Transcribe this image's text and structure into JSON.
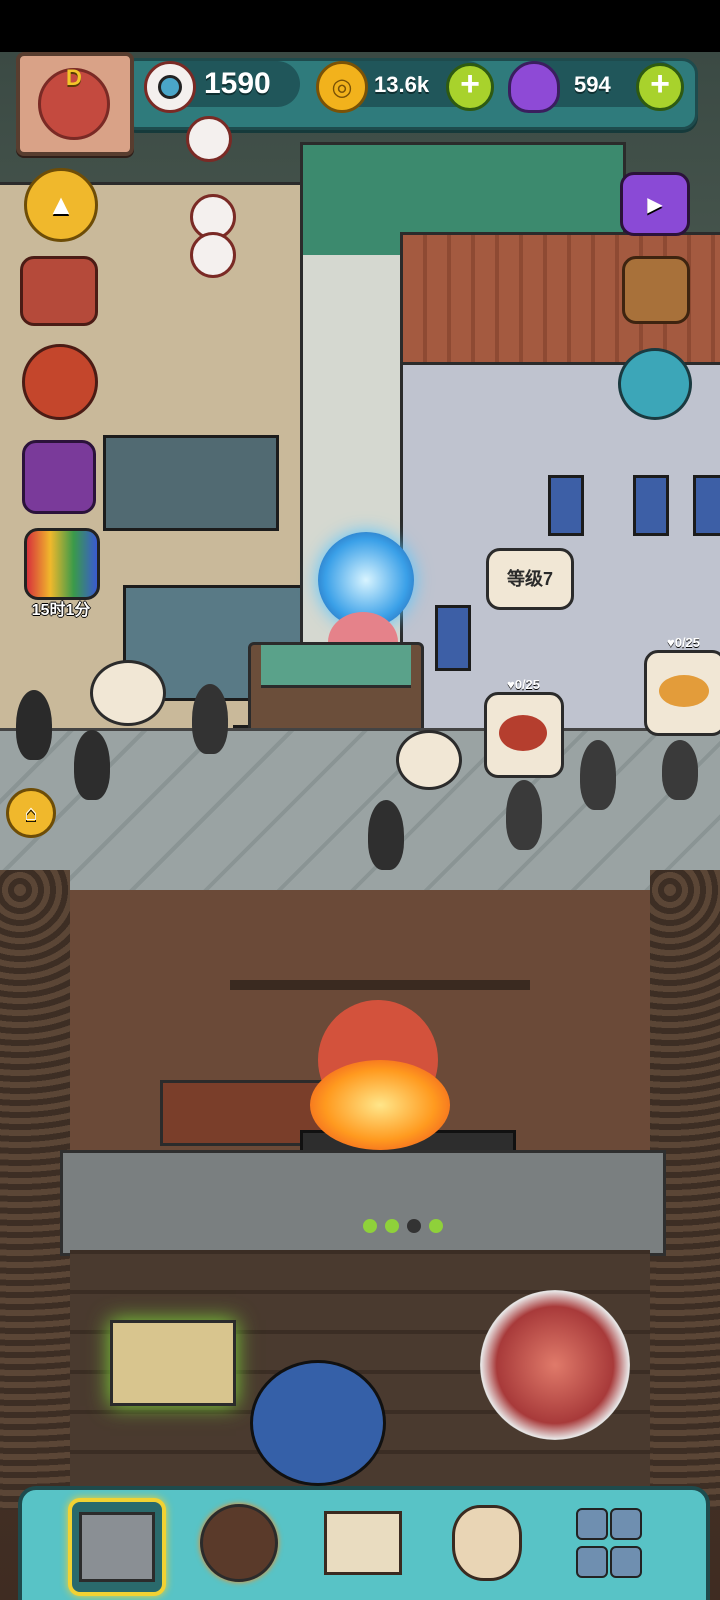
{
  "hud": {
    "avatar_letter": "D",
    "eyeballs": "1590",
    "coins": "13.6k",
    "potions": "594",
    "plus": "+"
  },
  "side": {
    "timer": "15时1分"
  },
  "world": {
    "level_bubble": "等级7",
    "order_1": "0/25",
    "order_2": "0/25"
  },
  "nav": {
    "items": [
      "restaurant",
      "monster",
      "recipes",
      "coin-bag",
      "grid"
    ]
  },
  "colors": {
    "hud_teal": "#2f7b7c",
    "plus_green": "#a8d22c",
    "nav_teal": "#58c3c6",
    "active_gold": "#f2d233"
  }
}
